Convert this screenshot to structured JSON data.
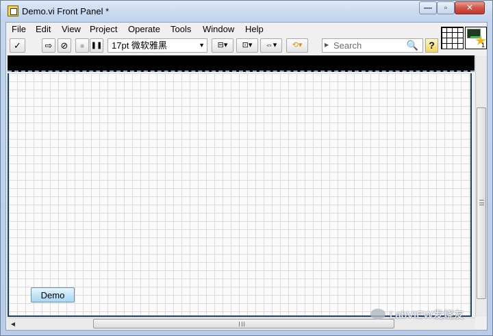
{
  "window": {
    "title": "Demo.vi Front Panel *",
    "minimize_glyph": "—",
    "maximize_glyph": "▫",
    "close_glyph": "✕"
  },
  "menu": {
    "items": [
      "File",
      "Edit",
      "View",
      "Project",
      "Operate",
      "Tools",
      "Window",
      "Help"
    ]
  },
  "toolbar": {
    "run_glyph": "✓",
    "run_continuous_glyph": "⇨",
    "abort_glyph": "⊘",
    "stop_glyph": "●",
    "pause_glyph": "❚❚",
    "font_label": "17pt 微软雅黑",
    "align_glyph": "⊟▾",
    "distribute_glyph": "⊡▾",
    "resize_glyph": "⇔▾",
    "reorder_glyph": "⟲▾",
    "search_placeholder": "Search",
    "help_glyph": "?"
  },
  "connector": {
    "terminal_count": "1"
  },
  "canvas": {
    "demo_button_label": "Demo"
  },
  "watermark": {
    "text": "LabVIEW发烧友"
  },
  "colors": {
    "accent_blue": "#16406b",
    "button_blue": "#c2e4f7",
    "close_red": "#c1392b"
  }
}
